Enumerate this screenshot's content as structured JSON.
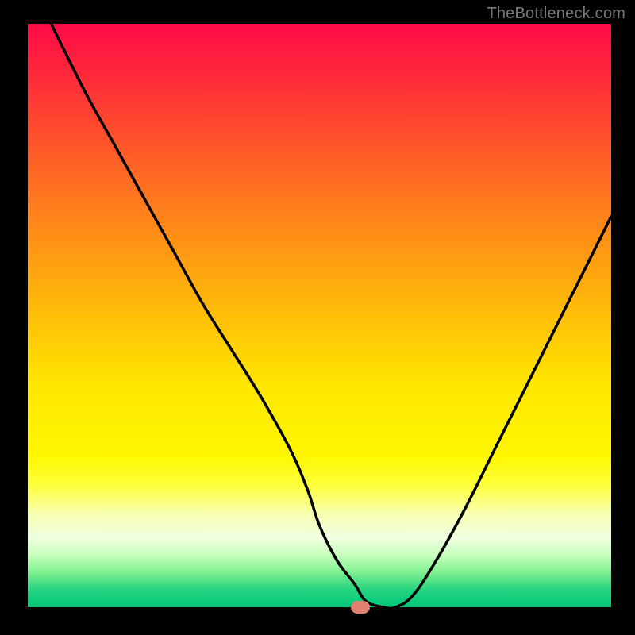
{
  "watermark": {
    "text": "TheBottleneck.com"
  },
  "colors": {
    "background": "#000000",
    "curve": "#000000",
    "marker": "#e08070",
    "gradient_top": "#ff0a48",
    "gradient_bottom": "#00c878"
  },
  "chart_data": {
    "type": "line",
    "title": "",
    "xlabel": "",
    "ylabel": "",
    "xlim": [
      0,
      100
    ],
    "ylim": [
      0,
      100
    ],
    "grid": false,
    "series": [
      {
        "name": "bottleneck-curve",
        "x": [
          4,
          10,
          15,
          20,
          25,
          30,
          35,
          40,
          45,
          48,
          50,
          53,
          56,
          58,
          61,
          63,
          66,
          70,
          75,
          80,
          85,
          90,
          95,
          100
        ],
        "y": [
          100,
          88,
          79,
          70,
          61,
          52,
          44,
          36,
          27,
          20,
          14,
          8,
          4,
          1,
          0,
          0,
          2,
          8,
          17,
          27,
          37,
          47,
          57,
          67
        ]
      }
    ],
    "annotations": [
      {
        "id": "min-marker",
        "x": 57,
        "y": 0,
        "shape": "pill",
        "color": "#e08070"
      }
    ],
    "background_gradient": {
      "orientation": "vertical",
      "stops": [
        {
          "pos": 0.0,
          "color": "#ff0a48"
        },
        {
          "pos": 0.22,
          "color": "#ff5a28"
        },
        {
          "pos": 0.48,
          "color": "#ffb80a"
        },
        {
          "pos": 0.74,
          "color": "#fff700"
        },
        {
          "pos": 0.88,
          "color": "#f0ffe0"
        },
        {
          "pos": 1.0,
          "color": "#00c878"
        }
      ]
    }
  }
}
